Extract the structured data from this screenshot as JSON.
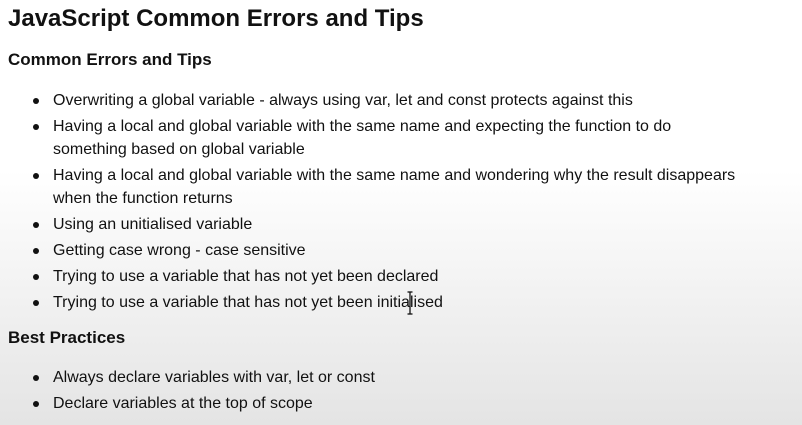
{
  "page": {
    "title": "JavaScript Common Errors and Tips"
  },
  "sections": {
    "errors": {
      "heading": "Common Errors and Tips",
      "items": [
        [
          "Overwriting a global variable - always using var, let and const protects against this"
        ],
        [
          "Having a local and global variable with the same name and expecting the function to do",
          "something based on global variable"
        ],
        [
          "Having a local and global variable with the same name and wondering why the result disappears",
          "when the function returns"
        ],
        [
          "Using an unitialised variable"
        ],
        [
          "Getting case wrong - case sensitive"
        ],
        [
          "Trying to use a variable that has not yet been declared"
        ],
        [
          "Trying to use a variable that has not yet been initialised"
        ]
      ]
    },
    "best": {
      "heading": "Best Practices",
      "items": [
        [
          "Always declare variables with var, let or const"
        ],
        [
          "Declare variables at the top of scope"
        ]
      ]
    }
  },
  "icons": {
    "cursor": "text-cursor-icon"
  }
}
